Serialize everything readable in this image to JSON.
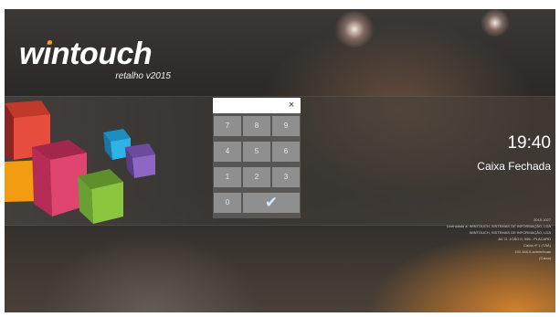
{
  "app": {
    "logo_name": "wintouch",
    "logo_subtitle": "retalho v2015"
  },
  "keypad": {
    "display_value": "",
    "clear_label": "×",
    "keys": [
      "7",
      "8",
      "9",
      "4",
      "5",
      "6",
      "1",
      "2",
      "3",
      "0"
    ],
    "confirm_icon": "check-icon",
    "confirm_glyph": "✔"
  },
  "clock": {
    "time": "19:40",
    "status": "Caixa Fechada"
  },
  "info_lines": [
    "2015.1027",
    "Licenciado a: WINTOUCH, SISTEMAS DE INFORMAÇÃO, LDA",
    "WINTOUCH, SISTEMAS DE INFORMAÇÃO, LDA",
    "AV. D. JOÃO II, 996 - PLACARD",
    "Caixa nº 1 (TÁÁ)",
    "192.168.0.admin/boas",
    "(Caixa)"
  ],
  "colors": {
    "logo_accent": "#f39c12",
    "confirm_check": "#d6e9f8",
    "key_background": "#8f8f8f"
  }
}
